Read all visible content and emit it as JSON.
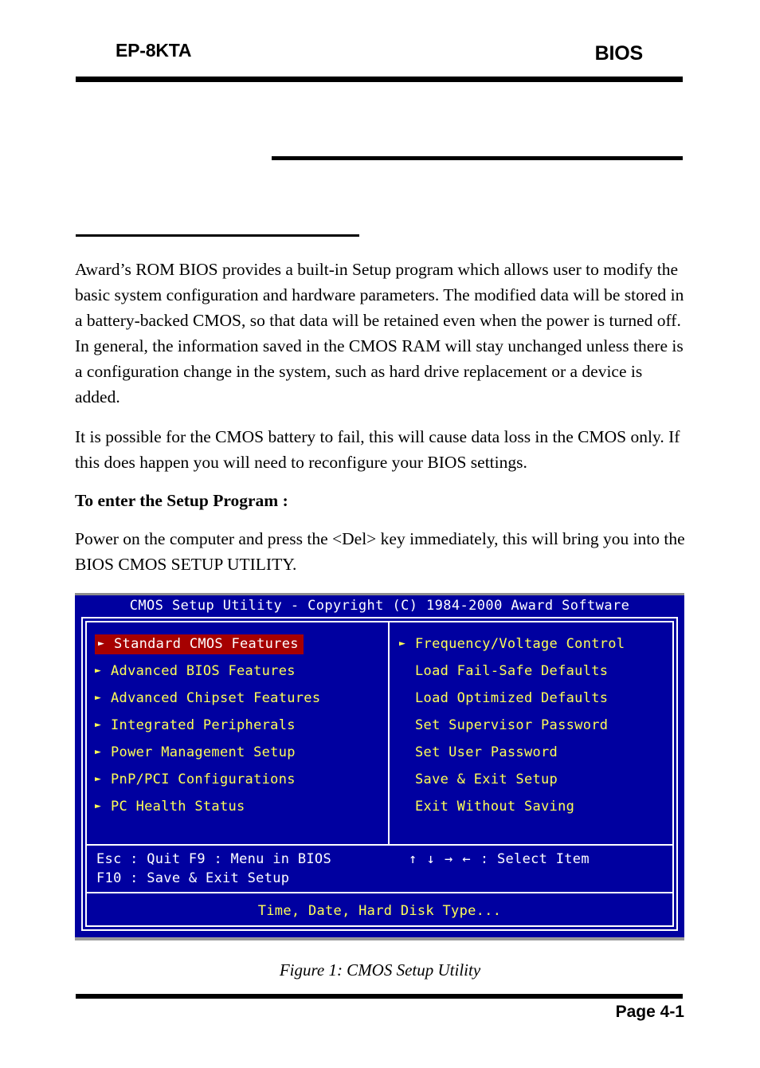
{
  "header": {
    "product": "EP-8KTA",
    "section": "BIOS"
  },
  "body": {
    "paragraph_1": "Award’s ROM BIOS provides a built-in Setup program which allows user to modify the basic system configuration and hardware parameters. The modified data will be stored in a battery-backed CMOS, so that data will be retained even when the power is turned off. In general, the information saved in the CMOS RAM will stay unchanged unless there is a configuration change in the system, such as hard drive replacement or a device is added.",
    "paragraph_2": "It is possible for the CMOS battery to fail, this will cause data loss in the CMOS only. If this does happen you will need to reconfigure your BIOS settings.",
    "subheading": "To enter the Setup Program :",
    "paragraph_3": "Power on the computer and press the <Del> key immediately, this will bring you into the BIOS CMOS SETUP UTILITY."
  },
  "bios": {
    "titlebar": "CMOS Setup Utility - Copyright (C) 1984-2000 Award Software",
    "colors": {
      "screen_background": "#0000a0",
      "menu_text": "#ffff55",
      "highlight_background": "#a60000",
      "highlight_text": "#ffffff",
      "border": "#ffffff",
      "help_text": "#ffffff",
      "status_text": "#ffff55"
    },
    "left_menu": [
      {
        "arrow": "►",
        "label": "Standard CMOS Features",
        "selected": true
      },
      {
        "arrow": "►",
        "label": "Advanced BIOS Features",
        "selected": false
      },
      {
        "arrow": "►",
        "label": "Advanced Chipset Features",
        "selected": false
      },
      {
        "arrow": "►",
        "label": "Integrated Peripherals",
        "selected": false
      },
      {
        "arrow": "►",
        "label": "Power Management Setup",
        "selected": false
      },
      {
        "arrow": "►",
        "label": "PnP/PCI Configurations",
        "selected": false
      },
      {
        "arrow": "►",
        "label": "PC Health Status",
        "selected": false
      }
    ],
    "right_menu": [
      {
        "arrow": "►",
        "label": "Frequency/Voltage Control",
        "selected": false
      },
      {
        "arrow": "",
        "label": "Load Fail-Safe Defaults",
        "selected": false
      },
      {
        "arrow": "",
        "label": "Load Optimized Defaults",
        "selected": false
      },
      {
        "arrow": "",
        "label": "Set Supervisor Password",
        "selected": false
      },
      {
        "arrow": "",
        "label": "Set User Password",
        "selected": false
      },
      {
        "arrow": "",
        "label": "Save & Exit Setup",
        "selected": false
      },
      {
        "arrow": "",
        "label": "Exit Without Saving",
        "selected": false
      }
    ],
    "help": {
      "line_1": "Esc : Quit        F9 : Menu in BIOS",
      "line_2": "F10 : Save & Exit Setup",
      "nav_keys": "↑ ↓ → ←",
      "nav_label": ": Select Item"
    },
    "status": "Time, Date, Hard Disk Type..."
  },
  "figure": {
    "caption": "Figure 1:  CMOS Setup Utility"
  },
  "footer": {
    "page": "Page 4-1"
  }
}
